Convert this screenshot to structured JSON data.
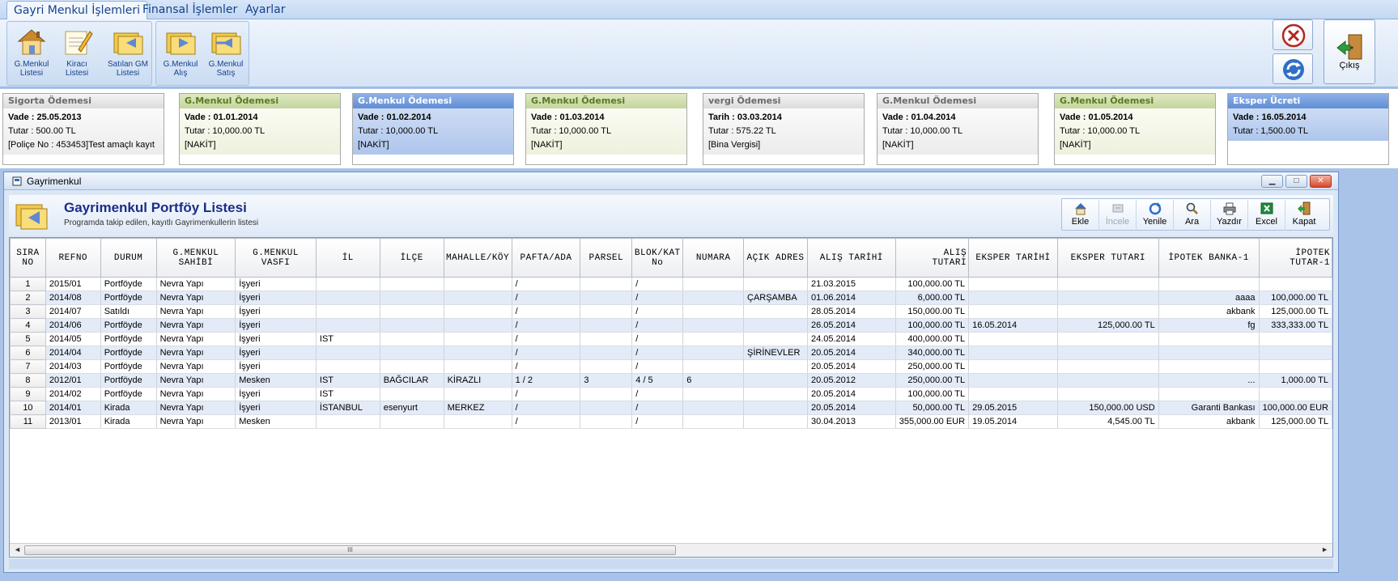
{
  "ribbon": {
    "tabs": [
      {
        "label": "Gayri Menkul İşlemleri",
        "active": true
      },
      {
        "label": "Finansal İşlemler",
        "active": false
      },
      {
        "label": "Ayarlar",
        "active": false
      }
    ],
    "buttons": [
      {
        "line1": "G.Menkul",
        "line2": "Listesi",
        "icon": "house-icon"
      },
      {
        "line1": "Kiracı",
        "line2": "Listesi",
        "icon": "pen-document-icon"
      },
      {
        "line1": "Satılan GM",
        "line2": "Listesi",
        "icon": "folder-sold-icon"
      },
      {
        "line1": "G.Menkul",
        "line2": "Alış",
        "icon": "folder-buy-icon"
      },
      {
        "line1": "G.Menkul",
        "line2": "Satış",
        "icon": "folder-sell-icon"
      }
    ],
    "exit_label": "Çıkış"
  },
  "cards": [
    {
      "title": "Sigorta Ödemesi",
      "style": "gray",
      "line1": "Vade : 25.05.2013",
      "line2": "Tutar : 500.00 TL",
      "line3": "[Poliçe No : 453453]Test amaçlı kayıt"
    },
    {
      "title": "G.Menkul Ödemesi",
      "style": "green",
      "line1": "Vade : 01.01.2014",
      "line2": "Tutar : 10,000.00 TL",
      "line3": "[NAKİT]"
    },
    {
      "title": "G.Menkul Ödemesi",
      "style": "blue",
      "line1": "Vade : 01.02.2014",
      "line2": "Tutar : 10,000.00 TL",
      "line3": "[NAKİT]"
    },
    {
      "title": "G.Menkul Ödemesi",
      "style": "green",
      "line1": "Vade : 01.03.2014",
      "line2": "Tutar : 10,000.00 TL",
      "line3": "[NAKİT]"
    },
    {
      "title": "vergi Ödemesi",
      "style": "gray",
      "line1": "Tarih : 03.03.2014",
      "line2": "Tutar : 575.22 TL",
      "line3": "[Bina Vergisi]"
    },
    {
      "title": "G.Menkul Ödemesi",
      "style": "gray",
      "line1": "Vade : 01.04.2014",
      "line2": "Tutar : 10,000.00 TL",
      "line3": "[NAKİT]"
    },
    {
      "title": "G.Menkul Ödemesi",
      "style": "green",
      "line1": "Vade : 01.05.2014",
      "line2": "Tutar : 10,000.00 TL",
      "line3": "[NAKİT]"
    },
    {
      "title": "Eksper Ücreti",
      "style": "blue",
      "line1": "Vade : 16.05.2014",
      "line2": "Tutar : 1,500.00 TL",
      "line3": ""
    }
  ],
  "window": {
    "title": "Gayrimenkul",
    "heading": "Gayrimenkul Portföy Listesi",
    "subheading": "Programda takip edilen, kayıtlı Gayrimenkullerin listesi",
    "toolbar": [
      {
        "label": "Ekle",
        "icon": "add-home-icon",
        "enabled": true
      },
      {
        "label": "İncele",
        "icon": "inspect-icon",
        "enabled": false
      },
      {
        "label": "Yenile",
        "icon": "refresh-icon",
        "enabled": true
      },
      {
        "label": "Ara",
        "icon": "search-icon",
        "enabled": true
      },
      {
        "label": "Yazdır",
        "icon": "printer-icon",
        "enabled": true
      },
      {
        "label": "Excel",
        "icon": "excel-icon",
        "enabled": true
      },
      {
        "label": "Kapat",
        "icon": "exit-icon",
        "enabled": true
      }
    ],
    "scroll_grip": "III"
  },
  "grid": {
    "columns": [
      "SIRA\nNO",
      "REFNO",
      "DURUM",
      "G.MENKUL\nSAHİBİ",
      "G.MENKUL\nVASFI",
      "İL",
      "İLÇE",
      "MAHALLE/KÖY",
      "PAFTA/ADA",
      "PARSEL",
      "BLOK/KAT\nNo",
      "NUMARA",
      "AÇIK ADRES",
      "ALIŞ TARİHİ",
      "ALIŞ\nTUTARI",
      "EKSPER TARİHİ",
      "EKSPER TUTARI",
      "İPOTEK BANKA-1",
      "İPOTEK\nTUTAR-1"
    ],
    "rows": [
      [
        "1",
        "2015/01",
        "Portföyde",
        "Nevra Yapı",
        "İşyeri",
        "",
        "",
        "",
        "/",
        "",
        "/",
        "",
        "",
        "21.03.2015",
        "100,000.00 TL",
        "",
        "",
        "",
        ""
      ],
      [
        "2",
        "2014/08",
        "Portföyde",
        "Nevra Yapı",
        "İşyeri",
        "",
        "",
        "",
        "/",
        "",
        "/",
        "",
        "ÇARŞAMBA",
        "01.06.2014",
        "6,000.00 TL",
        "",
        "",
        "aaaa",
        "100,000.00 TL"
      ],
      [
        "3",
        "2014/07",
        "Satıldı",
        "Nevra Yapı",
        "İşyeri",
        "",
        "",
        "",
        "/",
        "",
        "/",
        "",
        "",
        "28.05.2014",
        "150,000.00 TL",
        "",
        "",
        "akbank",
        "125,000.00 TL"
      ],
      [
        "4",
        "2014/06",
        "Portföyde",
        "Nevra Yapı",
        "İşyeri",
        "",
        "",
        "",
        "/",
        "",
        "/",
        "",
        "",
        "26.05.2014",
        "100,000.00 TL",
        "16.05.2014",
        "125,000.00 TL",
        "fg",
        "333,333.00 TL"
      ],
      [
        "5",
        "2014/05",
        "Portföyde",
        "Nevra Yapı",
        "İşyeri",
        "IST",
        "",
        "",
        "/",
        "",
        "/",
        "",
        "",
        "24.05.2014",
        "400,000.00 TL",
        "",
        "",
        "",
        ""
      ],
      [
        "6",
        "2014/04",
        "Portföyde",
        "Nevra Yapı",
        "İşyeri",
        "",
        "",
        "",
        "/",
        "",
        "/",
        "",
        "ŞİRİNEVLER",
        "20.05.2014",
        "340,000.00 TL",
        "",
        "",
        "",
        ""
      ],
      [
        "7",
        "2014/03",
        "Portföyde",
        "Nevra Yapı",
        "İşyeri",
        "",
        "",
        "",
        "/",
        "",
        "/",
        "",
        "",
        "20.05.2014",
        "250,000.00 TL",
        "",
        "",
        "",
        ""
      ],
      [
        "8",
        "2012/01",
        "Portföyde",
        "Nevra Yapı",
        "Mesken",
        "IST",
        "BAĞCILAR",
        "KİRAZLI",
        "1 / 2",
        "3",
        "4 / 5",
        "6",
        "",
        "20.05.2012",
        "250,000.00 TL",
        "",
        "",
        "...",
        "1,000.00 TL"
      ],
      [
        "9",
        "2014/02",
        "Portföyde",
        "Nevra Yapı",
        "İşyeri",
        "IST",
        "",
        "",
        "/",
        "",
        "/",
        "",
        "",
        "20.05.2014",
        "100,000.00 TL",
        "",
        "",
        "",
        ""
      ],
      [
        "10",
        "2014/01",
        "Kirada",
        "Nevra Yapı",
        "İşyeri",
        "İSTANBUL",
        "esenyurt",
        "MERKEZ",
        "/",
        "",
        "/",
        "",
        "",
        "20.05.2014",
        "50,000.00 TL",
        "29.05.2015",
        "150,000.00 USD",
        "Garanti Bankası",
        "100,000.00 EUR"
      ],
      [
        "11",
        "2013/01",
        "Kirada",
        "Nevra Yapı",
        "Mesken",
        "",
        "",
        "",
        "/",
        "",
        "/",
        "",
        "",
        "30.04.2013",
        "355,000.00 EUR",
        "19.05.2014",
        "4,545.00 TL",
        "akbank",
        "125,000.00 TL"
      ]
    ]
  }
}
